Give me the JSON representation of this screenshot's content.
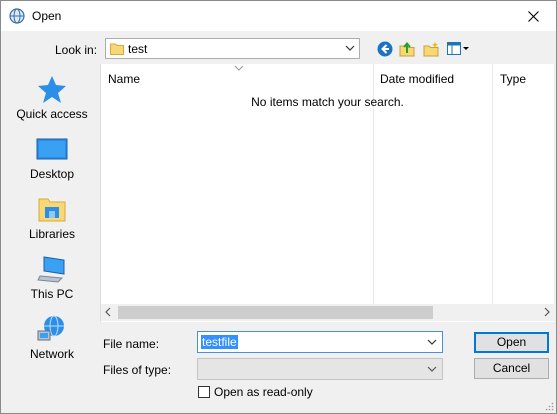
{
  "window": {
    "title": "Open"
  },
  "toolbar": {
    "look_in_label": "Look in:",
    "look_in_value": "test",
    "icons": [
      "back-icon",
      "up-folder-icon",
      "new-folder-icon",
      "view-menu-icon"
    ]
  },
  "places": [
    {
      "label": "Quick access",
      "icon": "star-icon"
    },
    {
      "label": "Desktop",
      "icon": "desktop-icon"
    },
    {
      "label": "Libraries",
      "icon": "libraries-icon"
    },
    {
      "label": "This PC",
      "icon": "computer-icon"
    },
    {
      "label": "Network",
      "icon": "network-icon"
    }
  ],
  "filelist": {
    "columns": [
      "Name",
      "Date modified",
      "Type"
    ],
    "empty_message": "No items match your search."
  },
  "form": {
    "file_name_label": "File name:",
    "file_name_value": "testfile",
    "files_of_type_label": "Files of type:",
    "files_of_type_value": "",
    "read_only_label": "Open as read-only"
  },
  "buttons": {
    "open": "Open",
    "cancel": "Cancel"
  },
  "colors": {
    "selection": "#3390ff",
    "focus_border": "#0078d7",
    "accent_blue": "#1e73be"
  }
}
